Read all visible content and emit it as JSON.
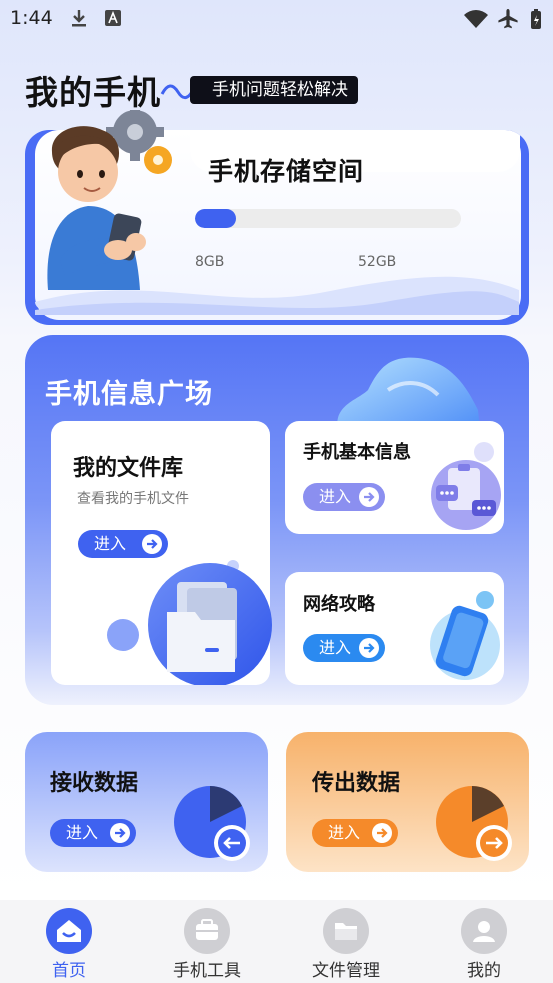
{
  "status_bar": {
    "time": "1:44"
  },
  "header": {
    "title": "我的手机",
    "slogan": "手机问题轻松解决"
  },
  "storage": {
    "title": "手机存储空间",
    "used_label": "8GB",
    "total_label": "52GB",
    "used_fraction": 0.154
  },
  "info_square": {
    "title": "手机信息广场",
    "file_library": {
      "title": "我的文件库",
      "subtitle": "查看我的手机文件",
      "button": "进入"
    },
    "basic_info": {
      "title": "手机基本信息",
      "button": "进入"
    },
    "network": {
      "title": "网络攻略",
      "button": "进入"
    }
  },
  "receive": {
    "title": "接收数据",
    "button": "进入"
  },
  "send": {
    "title": "传出数据",
    "button": "进入"
  },
  "tab_bar": {
    "tabs": [
      {
        "label": "首页",
        "icon": "home-icon",
        "active": true
      },
      {
        "label": "手机工具",
        "icon": "toolbox-icon",
        "active": false
      },
      {
        "label": "文件管理",
        "icon": "folder-icon",
        "active": false
      },
      {
        "label": "我的",
        "icon": "user-icon",
        "active": false
      }
    ]
  },
  "colors": {
    "accent": "#3f62f0",
    "orange": "#f58a2a",
    "active_tab": "#3f62f0"
  }
}
